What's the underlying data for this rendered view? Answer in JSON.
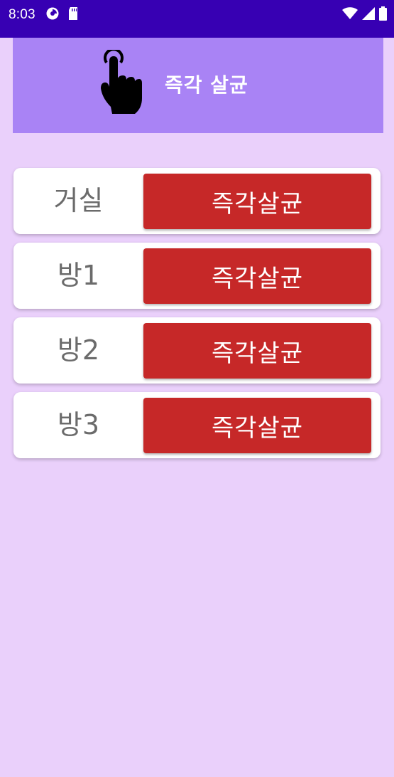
{
  "status_bar": {
    "time": "8:03",
    "background": "#3700b3",
    "left_icons": [
      "data-saver-icon",
      "sd-card-icon"
    ],
    "right_icons": [
      "wifi-icon",
      "signal-icon",
      "battery-icon"
    ]
  },
  "header": {
    "icon": "pointing-hand-icon",
    "title": "즉각 살균",
    "background": "#a983f5"
  },
  "rooms": [
    {
      "name": "거실",
      "button_label": "즉각살균"
    },
    {
      "name": "방1",
      "button_label": "즉각살균"
    },
    {
      "name": "방2",
      "button_label": "즉각살균"
    },
    {
      "name": "방3",
      "button_label": "즉각살균"
    }
  ],
  "colors": {
    "page_background": "#ead0fb",
    "button_red": "#c62828",
    "room_text": "#6b6b6b"
  }
}
